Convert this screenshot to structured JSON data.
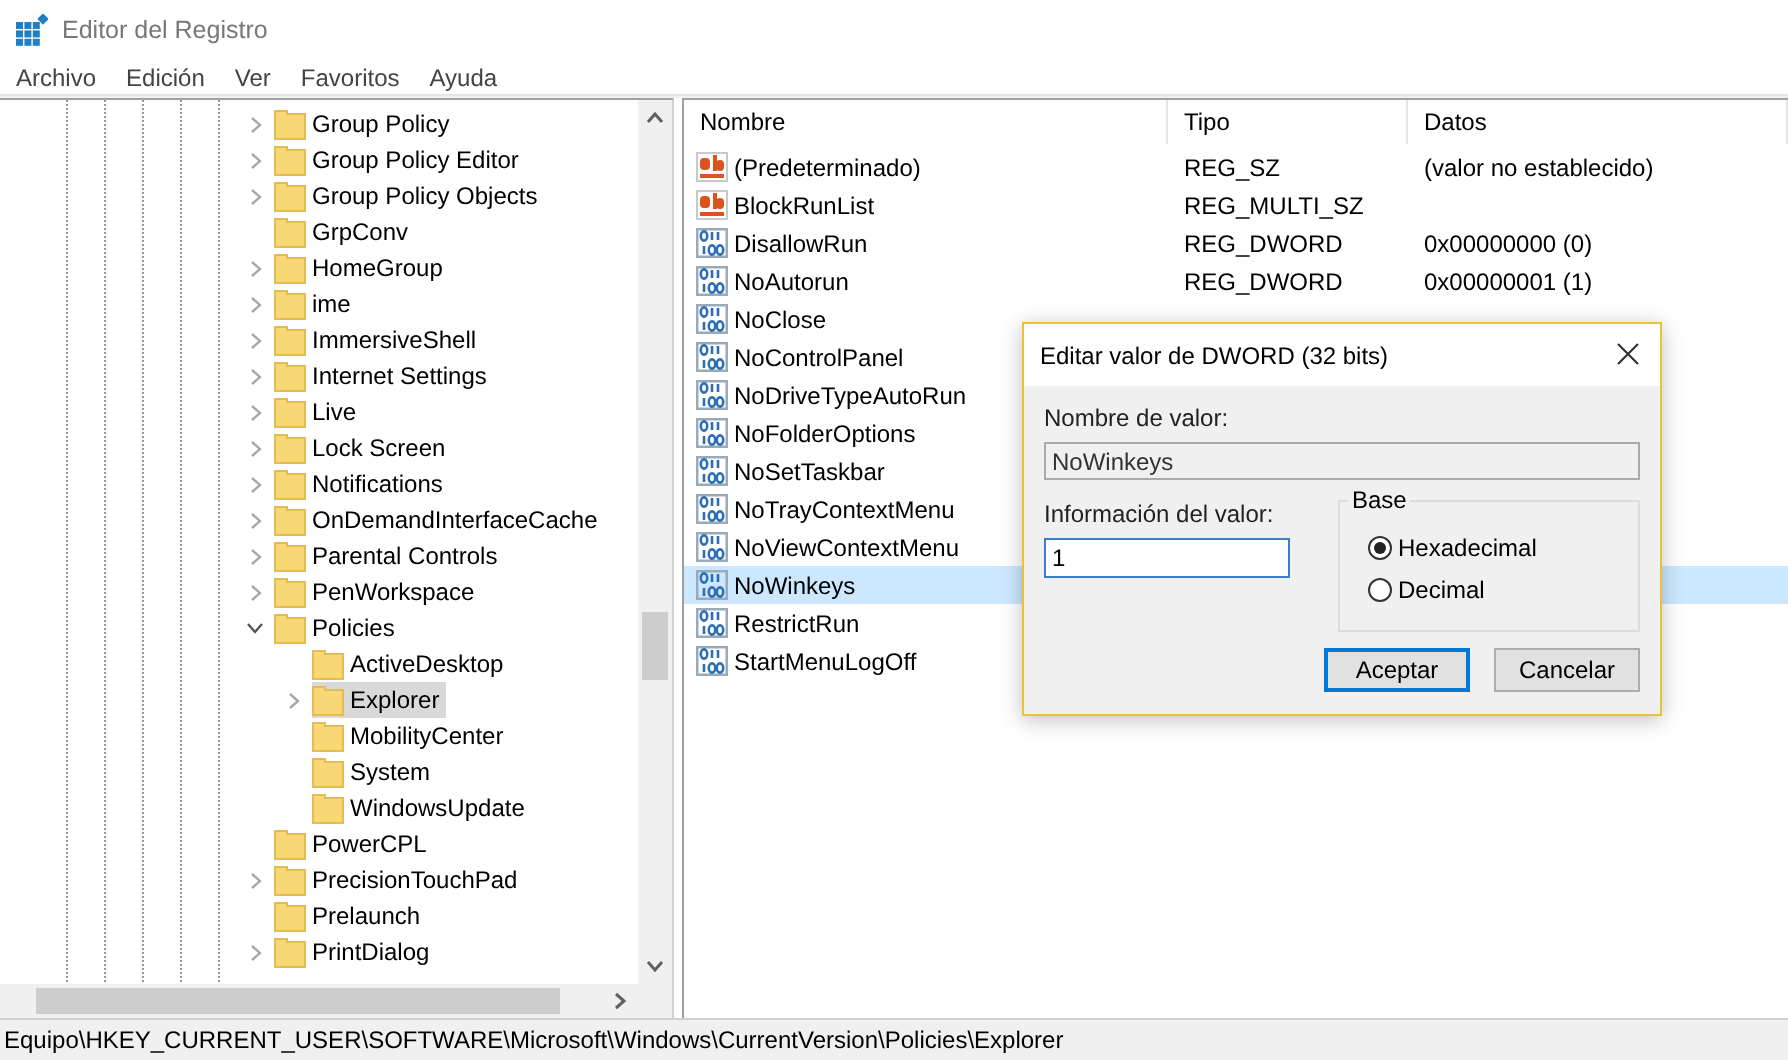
{
  "window": {
    "title": "Editor del Registro"
  },
  "menu": [
    "Archivo",
    "Edición",
    "Ver",
    "Favoritos",
    "Ayuda"
  ],
  "tree": {
    "items": [
      {
        "kind": "collapsed",
        "label": "Group Policy",
        "selected": false
      },
      {
        "kind": "collapsed",
        "label": "Group Policy Editor",
        "selected": false
      },
      {
        "kind": "collapsed",
        "label": "Group Policy Objects",
        "selected": false
      },
      {
        "kind": "leaf",
        "label": "GrpConv",
        "selected": false
      },
      {
        "kind": "collapsed",
        "label": "HomeGroup",
        "selected": false
      },
      {
        "kind": "collapsed",
        "label": "ime",
        "selected": false
      },
      {
        "kind": "collapsed",
        "label": "ImmersiveShell",
        "selected": false
      },
      {
        "kind": "collapsed",
        "label": "Internet Settings",
        "selected": false
      },
      {
        "kind": "collapsed",
        "label": "Live",
        "selected": false
      },
      {
        "kind": "collapsed",
        "label": "Lock Screen",
        "selected": false
      },
      {
        "kind": "collapsed",
        "label": "Notifications",
        "selected": false
      },
      {
        "kind": "collapsed",
        "label": "OnDemandInterfaceCache",
        "selected": false
      },
      {
        "kind": "collapsed",
        "label": "Parental Controls",
        "selected": false
      },
      {
        "kind": "collapsed",
        "label": "PenWorkspace",
        "selected": false
      },
      {
        "kind": "expanded",
        "label": "Policies",
        "selected": false,
        "children": [
          {
            "kind": "leaf",
            "label": "ActiveDesktop",
            "selected": false
          },
          {
            "kind": "collapsed",
            "label": "Explorer",
            "selected": true
          },
          {
            "kind": "leaf",
            "label": "MobilityCenter",
            "selected": false
          },
          {
            "kind": "leaf",
            "label": "System",
            "selected": false
          },
          {
            "kind": "leaf",
            "label": "WindowsUpdate",
            "selected": false
          }
        ]
      },
      {
        "kind": "leaf",
        "label": "PowerCPL",
        "selected": false
      },
      {
        "kind": "collapsed",
        "label": "PrecisionTouchPad",
        "selected": false
      },
      {
        "kind": "leaf",
        "label": "Prelaunch",
        "selected": false
      },
      {
        "kind": "collapsed",
        "label": "PrintDialog",
        "selected": false
      }
    ]
  },
  "list": {
    "columns": [
      "Nombre",
      "Tipo",
      "Datos"
    ],
    "rows": [
      {
        "kind": "sz",
        "name": "(Predeterminado)",
        "type": "REG_SZ",
        "data": "(valor no establecido)",
        "selected": false
      },
      {
        "kind": "sz",
        "name": "BlockRunList",
        "type": "REG_MULTI_SZ",
        "selected": false
      },
      {
        "kind": "dword",
        "name": "DisallowRun",
        "type": "REG_DWORD",
        "data": "0x00000000 (0)",
        "selected": false
      },
      {
        "kind": "dword",
        "name": "NoAutorun",
        "type": "REG_DWORD",
        "data": "0x00000001 (1)",
        "selected": false
      },
      {
        "kind": "dword",
        "name": "NoClose",
        "selected": false
      },
      {
        "kind": "dword",
        "name": "NoControlPanel",
        "selected": false
      },
      {
        "kind": "dword",
        "name": "NoDriveTypeAutoRun",
        "selected": false
      },
      {
        "kind": "dword",
        "name": "NoFolderOptions",
        "selected": false
      },
      {
        "kind": "dword",
        "name": "NoSetTaskbar",
        "selected": false
      },
      {
        "kind": "dword",
        "name": "NoTrayContextMenu",
        "selected": false
      },
      {
        "kind": "dword",
        "name": "NoViewContextMenu",
        "selected": false
      },
      {
        "kind": "dword",
        "name": "NoWinkeys",
        "selected": true
      },
      {
        "kind": "dword",
        "name": "RestrictRun",
        "selected": false
      },
      {
        "kind": "dword",
        "name": "StartMenuLogOff",
        "selected": false
      }
    ]
  },
  "dialog": {
    "title": "Editar valor de DWORD (32 bits)",
    "name_label": "Nombre de valor:",
    "name_value": "NoWinkeys",
    "data_label": "Información del valor:",
    "data_value": "1",
    "base": {
      "title": "Base",
      "options": [
        {
          "label": "Hexadecimal",
          "selected": true
        },
        {
          "label": "Decimal",
          "selected": false
        }
      ]
    },
    "buttons": [
      {
        "label": "Aceptar",
        "default": true
      },
      {
        "label": "Cancelar",
        "default": false
      }
    ]
  },
  "status_bar": "Equipo\\HKEY_CURRENT_USER\\SOFTWARE\\Microsoft\\Windows\\CurrentVersion\\Policies\\Explorer"
}
